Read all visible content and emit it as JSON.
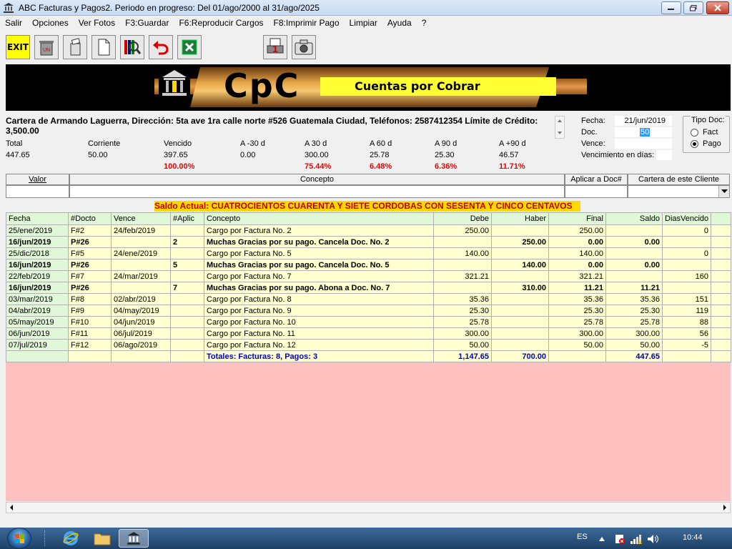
{
  "window": {
    "title": "ABC Facturas y Pagos2. Periodo en progreso: Del 01/ago/2000 al 31/ago/2025"
  },
  "menu": [
    "Salir",
    "Opciones",
    "Ver Fotos",
    "F3:Guardar",
    "F6:Reproducir Cargos",
    "F8:Imprimir Pago",
    "Limpiar",
    "Ayuda",
    "?"
  ],
  "toolbar": {
    "exit_label": "EXIT"
  },
  "banner": {
    "logo": "CpC",
    "subtitle": "Cuentas por Cobrar"
  },
  "cliente": {
    "info": "Cartera de Armando Laguerra, Dirección: 5ta ave 1ra calle norte #526 Guatemala Ciudad, Teléfonos: 2587412354 Límite de Crédito: 3,500.00"
  },
  "resumen": {
    "headers": [
      "Total",
      "Corriente",
      "Vencido",
      "A -30 d",
      "A 30 d",
      "A 60 d",
      "A 90 d",
      "A +90 d"
    ],
    "values": [
      "447.65",
      "50.00",
      "397.65",
      "0.00",
      "300.00",
      "25.78",
      "25.30",
      "46.57"
    ],
    "percents": [
      "",
      "",
      "100.00%",
      "",
      "75.44%",
      "6.48%",
      "6.36%",
      "11.71%"
    ]
  },
  "doc": {
    "fecha_label": "Fecha:",
    "fecha": "21/jun/2019",
    "doc_label": "Doc.",
    "doc": "50",
    "vence_label": "Vence:",
    "vence": "",
    "venc_dias_label": "Vencimiento en días:",
    "venc_dias": ""
  },
  "tipo_doc": {
    "legend": "Tipo Doc:",
    "options": [
      "Fact",
      "Pago"
    ],
    "selected": "Pago"
  },
  "entrada": {
    "headers": [
      "Valor",
      "Concepto",
      "Aplicar a Doc#",
      "Cartera de este Cliente"
    ]
  },
  "saldo_actual": "Saldo Actual: CUATROCIENTOS CUARENTA Y SIETE CORDOBAS CON SESENTA Y CINCO CENTAVOS",
  "tabla": {
    "columns": [
      "Fecha",
      "#Docto",
      "Vence",
      "#Aplic",
      "Concepto",
      "Debe",
      "Haber",
      "Final",
      "Saldo",
      "DiasVencido"
    ],
    "rows": [
      {
        "fecha": "25/ene/2019",
        "docto": "F#2",
        "vence": "24/feb/2019",
        "aplic": "",
        "concepto": "Cargo por Factura No. 2",
        "debe": "250.00",
        "haber": "",
        "final": "250.00",
        "saldo": "",
        "dias": "0",
        "pago": false
      },
      {
        "fecha": "16/jun/2019",
        "docto": "P#26",
        "vence": "",
        "aplic": "2",
        "concepto": "Muchas Gracias por su pago. Cancela Doc. No. 2",
        "debe": "",
        "haber": "250.00",
        "final": "0.00",
        "saldo": "0.00",
        "dias": "",
        "pago": true
      },
      {
        "fecha": "25/dic/2018",
        "docto": "F#5",
        "vence": "24/ene/2019",
        "aplic": "",
        "concepto": "Cargo por Factura No. 5",
        "debe": "140.00",
        "haber": "",
        "final": "140.00",
        "saldo": "",
        "dias": "0",
        "pago": false
      },
      {
        "fecha": "16/jun/2019",
        "docto": "P#26",
        "vence": "",
        "aplic": "5",
        "concepto": "Muchas Gracias por su pago. Cancela Doc. No. 5",
        "debe": "",
        "haber": "140.00",
        "final": "0.00",
        "saldo": "0.00",
        "dias": "",
        "pago": true
      },
      {
        "fecha": "22/feb/2019",
        "docto": "F#7",
        "vence": "24/mar/2019",
        "aplic": "",
        "concepto": "Cargo por Factura No. 7",
        "debe": "321.21",
        "haber": "",
        "final": "321.21",
        "saldo": "",
        "dias": "160",
        "pago": false
      },
      {
        "fecha": "16/jun/2019",
        "docto": "P#26",
        "vence": "",
        "aplic": "7",
        "concepto": "Muchas Gracias por su pago. Abona a Doc. No. 7",
        "debe": "",
        "haber": "310.00",
        "final": "11.21",
        "saldo": "11.21",
        "dias": "",
        "pago": true
      },
      {
        "fecha": "03/mar/2019",
        "docto": "F#8",
        "vence": "02/abr/2019",
        "aplic": "",
        "concepto": "Cargo por Factura No. 8",
        "debe": "35.36",
        "haber": "",
        "final": "35.36",
        "saldo": "35.36",
        "dias": "151",
        "pago": false
      },
      {
        "fecha": "04/abr/2019",
        "docto": "F#9",
        "vence": "04/may/2019",
        "aplic": "",
        "concepto": "Cargo por Factura No. 9",
        "debe": "25.30",
        "haber": "",
        "final": "25.30",
        "saldo": "25.30",
        "dias": "119",
        "pago": false
      },
      {
        "fecha": "05/may/2019",
        "docto": "F#10",
        "vence": "04/jun/2019",
        "aplic": "",
        "concepto": "Cargo por Factura No. 10",
        "debe": "25.78",
        "haber": "",
        "final": "25.78",
        "saldo": "25.78",
        "dias": "88",
        "pago": false
      },
      {
        "fecha": "06/jun/2019",
        "docto": "F#11",
        "vence": "06/jul/2019",
        "aplic": "",
        "concepto": "Cargo por Factura No. 11",
        "debe": "300.00",
        "haber": "",
        "final": "300.00",
        "saldo": "300.00",
        "dias": "56",
        "pago": false
      },
      {
        "fecha": "07/jul/2019",
        "docto": "F#12",
        "vence": "06/ago/2019",
        "aplic": "",
        "concepto": "Cargo por Factura No. 12",
        "debe": "50.00",
        "haber": "",
        "final": "50.00",
        "saldo": "50.00",
        "dias": "-5",
        "pago": false
      }
    ],
    "totales": {
      "concepto": "Totales: Facturas: 8, Pagos: 3",
      "debe": "1,147.65",
      "haber": "700.00",
      "saldo": "447.65"
    }
  },
  "taskbar": {
    "lang": "ES",
    "clock": "10:44"
  },
  "colors": {
    "grid_bg": "#ffc0c0",
    "row_bg": "#ffffd0",
    "header_bg": "#e0f7d8",
    "accent_yellow": "#ffd800",
    "percent_red": "#e00000",
    "totals_blue": "#0000c0"
  }
}
